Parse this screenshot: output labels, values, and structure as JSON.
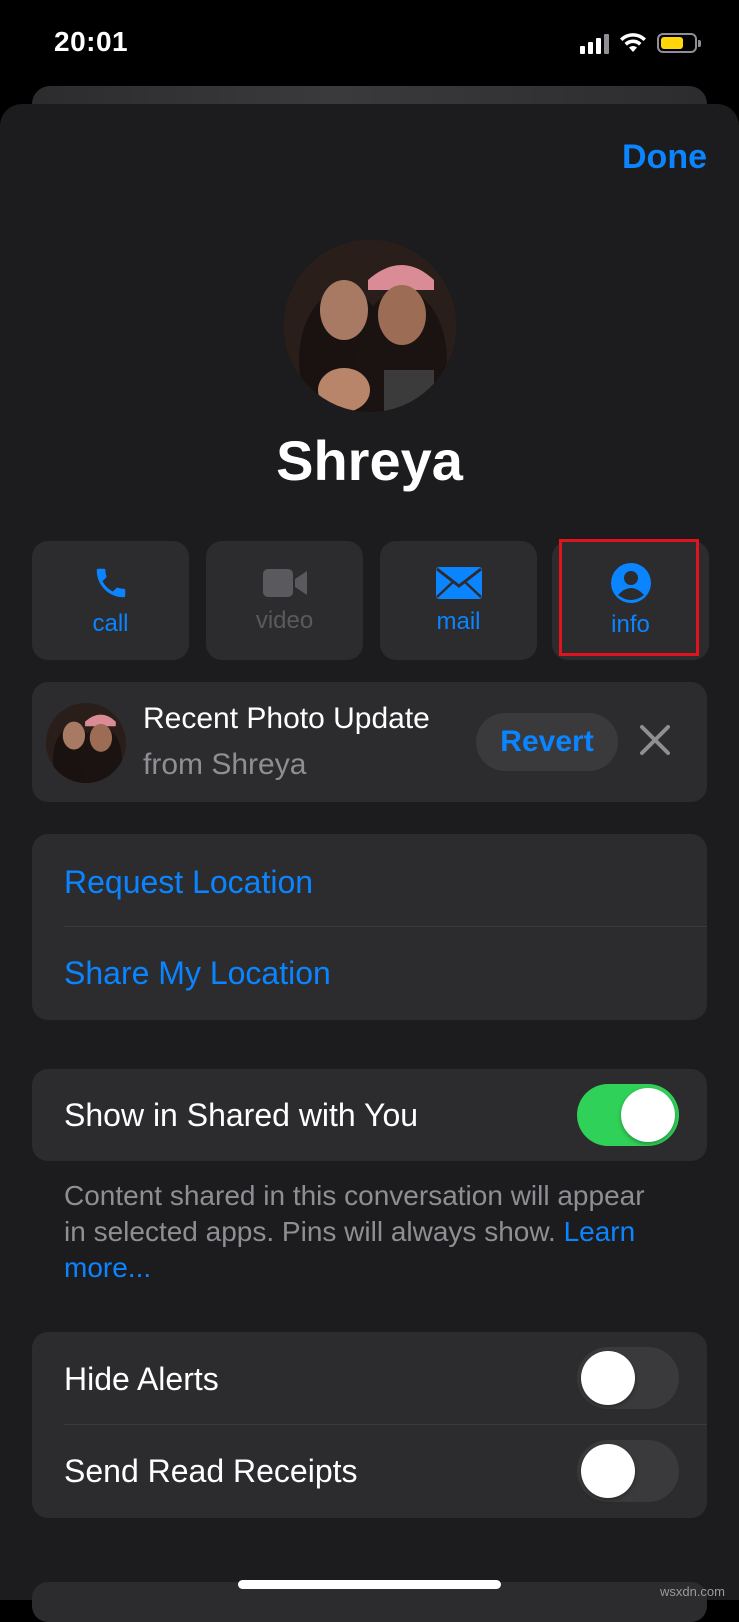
{
  "status_bar": {
    "time": "20:01",
    "signal_icon": "signal-icon",
    "wifi_icon": "wifi-icon",
    "battery_icon": "battery-icon"
  },
  "header": {
    "done_label": "Done"
  },
  "contact": {
    "name": "Shreya"
  },
  "actions": [
    {
      "label": "call",
      "icon": "phone-icon",
      "enabled": true
    },
    {
      "label": "video",
      "icon": "video-camera-icon",
      "enabled": false
    },
    {
      "label": "mail",
      "icon": "envelope-icon",
      "enabled": true
    },
    {
      "label": "info",
      "icon": "person-circle-icon",
      "enabled": true,
      "highlighted": true
    }
  ],
  "photo_update": {
    "title": "Recent Photo Update",
    "subtitle": "from Shreya",
    "revert_label": "Revert"
  },
  "location": {
    "request_label": "Request Location",
    "share_label": "Share My Location"
  },
  "shared_with_you": {
    "label": "Show in Shared with You",
    "enabled": true,
    "footnote": "Content shared in this conversation will appear in selected apps. Pins will always show.",
    "learn_more": "Learn more..."
  },
  "alerts": {
    "hide_alerts_label": "Hide Alerts",
    "hide_alerts_enabled": false,
    "read_receipts_label": "Send Read Receipts",
    "read_receipts_enabled": false
  },
  "watermark": "wsxdn.com",
  "colors": {
    "accent": "#0a84ff",
    "toggle_on": "#30d158",
    "highlight_box": "#e0141e",
    "sheet_bg": "#1c1c1e",
    "card_bg": "#2c2c2e"
  }
}
